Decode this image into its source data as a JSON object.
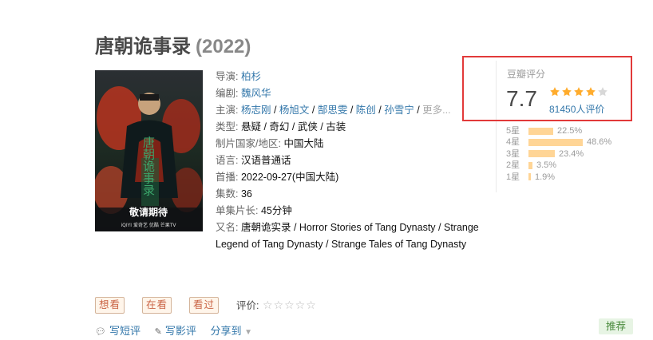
{
  "movie": {
    "title": "唐朝诡事录",
    "year": "(2022)"
  },
  "poster": {
    "slogan": "敬请期待",
    "title_art": "唐朝诡事录",
    "logos": "iQIYI 爱奇艺  优酷  芒果TV"
  },
  "info": {
    "director_label": "导演",
    "director": "柏杉",
    "writer_label": "编剧",
    "writer": "魏风华",
    "cast_label": "主演",
    "cast": [
      "杨志刚",
      "杨旭文",
      "郜思雯",
      "陈创",
      "孙雪宁"
    ],
    "more": "更多...",
    "genre_label": "类型:",
    "genres": [
      "悬疑",
      "奇幻",
      "武侠",
      "古装"
    ],
    "country_label": "制片国家/地区:",
    "country": "中国大陆",
    "language_label": "语言:",
    "language": "汉语普通话",
    "release_label": "首播:",
    "release": "2022-09-27(中国大陆)",
    "episodes_label": "集数:",
    "episodes": "36",
    "runtime_label": "单集片长:",
    "runtime": "45分钟",
    "aka_label": "又名:",
    "aka": "唐朝诡实录 / Horror Stories of Tang Dynasty / Strange Legend of Tang Dynasty / Strange Tales of Tang Dynasty"
  },
  "rating": {
    "label": "豆瓣评分",
    "score": "7.7",
    "stars": 4,
    "count": "81450人评价",
    "distribution": [
      {
        "label": "5星",
        "pct": "22.5%",
        "value": 22.5
      },
      {
        "label": "4星",
        "pct": "48.6%",
        "value": 48.6
      },
      {
        "label": "3星",
        "pct": "23.4%",
        "value": 23.4
      },
      {
        "label": "2星",
        "pct": "3.5%",
        "value": 3.5
      },
      {
        "label": "1星",
        "pct": "1.9%",
        "value": 1.9
      }
    ],
    "highlight_color": "#e23a3a"
  },
  "buttons": {
    "want": "想看",
    "watching": "在看",
    "watched": "看过"
  },
  "my_rating": {
    "label": "评价:"
  },
  "actions": {
    "short_review": "写短评",
    "review": "写影评",
    "share": "分享到"
  },
  "recommend": "推荐"
}
